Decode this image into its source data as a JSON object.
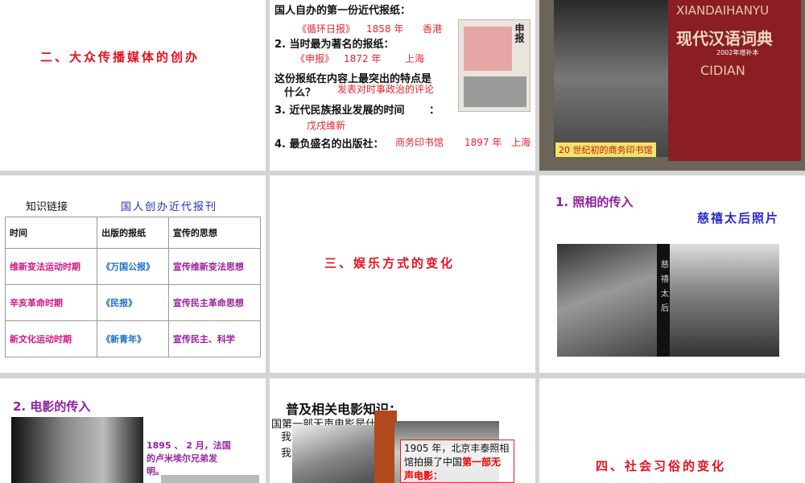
{
  "slides": [
    {
      "title": "二、大众传播媒体的创办"
    },
    {
      "q1": "国人自办的第一份近代报纸：",
      "a1a": "《循环日报》",
      "a1b": "1858 年",
      "a1c": "香港",
      "q2": "2. 当时最为著名的报纸：",
      "a2a": "《申报》",
      "a2b": "1872 年",
      "a2c": "上海",
      "q2b": "这份报纸在内容上最突出的特点是",
      "q2c": "什么？",
      "a2d": "发表对时事政治的评论",
      "q3": "3. 近代民族报业发展的时间",
      "q3colon": "：",
      "a3": "戊戌维新",
      "q4": "4. 最负盛名的出版社：",
      "a4a": "商务印书馆",
      "a4b": "1897 年",
      "a4c": "上海",
      "image_label": "申报"
    },
    {
      "caption": "20 世纪初的商务印书馆",
      "book_title_en": "XIANDAIHANYU",
      "book_title_cn": "现代汉语词典",
      "book_sub": "CIDIAN",
      "book_edition": "2002年增补本"
    },
    {
      "label": "知识链接",
      "heading": "国人创办近代报刊",
      "headers": [
        "时间",
        "出版的报纸",
        "宣传的思想"
      ],
      "rows": [
        [
          "维新变法运动时期",
          "《万国公报》",
          "宣传维新变法思想"
        ],
        [
          "辛亥革命时期",
          "《民报》",
          "宣传民主革命思想"
        ],
        [
          "新文化运动时期",
          "《新青年》",
          "宣传民主、科学"
        ]
      ]
    },
    {
      "title": "三、娱乐方式的变化"
    },
    {
      "heading": "1. 照相的传入",
      "caption": "慈禧太后照片",
      "vertical": "慈禧太后"
    },
    {
      "heading": "2. 电影的传入",
      "text": "1895 、 2 月，法国的卢米埃尔兄弟发明。"
    },
    {
      "heading": "普及相关电影知识：",
      "line1": "国第一部无声电影是什么？",
      "line2": "我",
      "line3": "我",
      "box": "1905 年，北京丰泰照相馆拍摄了中国",
      "box_red": "第一部无声电影："
    },
    {
      "title": "四、社会习俗的变化"
    }
  ],
  "colors": {
    "title": "#e8101e",
    "accent": "#8e1f9e"
  }
}
